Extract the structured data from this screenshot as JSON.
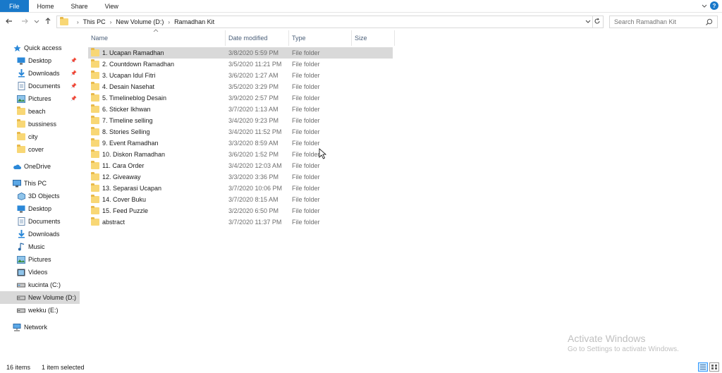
{
  "ribbon": {
    "tabs": [
      "File",
      "Home",
      "Share",
      "View"
    ]
  },
  "address": {
    "crumbs": [
      "This PC",
      "New Volume (D:)",
      "Ramadhan Kit"
    ]
  },
  "search": {
    "placeholder": "Search Ramadhan Kit"
  },
  "sidebar": {
    "items": [
      {
        "label": "Quick access",
        "icon": "star-icon"
      },
      {
        "label": "Desktop",
        "icon": "desktop-icon",
        "pinned": true
      },
      {
        "label": "Downloads",
        "icon": "download-icon",
        "pinned": true
      },
      {
        "label": "Documents",
        "icon": "documents-icon",
        "pinned": true
      },
      {
        "label": "Pictures",
        "icon": "pictures-icon",
        "pinned": true
      },
      {
        "label": "beach",
        "icon": "folder-icon"
      },
      {
        "label": "bussiness",
        "icon": "folder-icon"
      },
      {
        "label": "city",
        "icon": "folder-icon"
      },
      {
        "label": "cover",
        "icon": "folder-icon"
      },
      {
        "label": "OneDrive",
        "icon": "cloud-icon"
      },
      {
        "label": "This PC",
        "icon": "computer-icon"
      },
      {
        "label": "3D Objects",
        "icon": "cube-icon"
      },
      {
        "label": "Desktop",
        "icon": "desktop-icon"
      },
      {
        "label": "Documents",
        "icon": "documents-icon"
      },
      {
        "label": "Downloads",
        "icon": "download-icon"
      },
      {
        "label": "Music",
        "icon": "music-icon"
      },
      {
        "label": "Pictures",
        "icon": "pictures-icon"
      },
      {
        "label": "Videos",
        "icon": "video-icon"
      },
      {
        "label": "kucinta (C:)",
        "icon": "drive-icon"
      },
      {
        "label": "New Volume (D:)",
        "icon": "drive-icon"
      },
      {
        "label": "wekku (E:)",
        "icon": "drive-icon"
      },
      {
        "label": "Network",
        "icon": "network-icon"
      }
    ]
  },
  "columns": {
    "name": "Name",
    "date": "Date modified",
    "type": "Type",
    "size": "Size"
  },
  "files": [
    {
      "name": "1. Ucapan Ramadhan",
      "date": "3/8/2020 5:59 PM",
      "type": "File folder"
    },
    {
      "name": "2. Countdown Ramadhan",
      "date": "3/5/2020 11:21 PM",
      "type": "File folder"
    },
    {
      "name": "3. Ucapan Idul Fitri",
      "date": "3/6/2020 1:27 AM",
      "type": "File folder"
    },
    {
      "name": "4. Desain Nasehat",
      "date": "3/5/2020 3:29 PM",
      "type": "File folder"
    },
    {
      "name": "5. Timelineblog Desain",
      "date": "3/9/2020 2:57 PM",
      "type": "File folder"
    },
    {
      "name": "6. Sticker Ikhwan",
      "date": "3/7/2020 1:13 AM",
      "type": "File folder"
    },
    {
      "name": "7. Timeline selling",
      "date": "3/4/2020 9:23 PM",
      "type": "File folder"
    },
    {
      "name": "8. Stories Selling",
      "date": "3/4/2020 11:52 PM",
      "type": "File folder"
    },
    {
      "name": "9. Event Ramadhan",
      "date": "3/3/2020 8:59 AM",
      "type": "File folder"
    },
    {
      "name": "10. Diskon Ramadhan",
      "date": "3/6/2020 1:52 PM",
      "type": "File folder"
    },
    {
      "name": "11. Cara Order",
      "date": "3/4/2020 12:03 AM",
      "type": "File folder"
    },
    {
      "name": "12. Giveaway",
      "date": "3/3/2020 3:36 PM",
      "type": "File folder"
    },
    {
      "name": "13. Separasi Ucapan",
      "date": "3/7/2020 10:06 PM",
      "type": "File folder"
    },
    {
      "name": "14. Cover Buku",
      "date": "3/7/2020 8:15 AM",
      "type": "File folder"
    },
    {
      "name": "15. Feed Puzzle",
      "date": "3/2/2020 6:50 PM",
      "type": "File folder"
    },
    {
      "name": "abstract",
      "date": "3/7/2020 11:37 PM",
      "type": "File folder"
    }
  ],
  "status": {
    "items": "16 items",
    "selected": "1 item selected"
  },
  "watermark": {
    "title": "Activate Windows",
    "subtitle": "Go to Settings to activate Windows."
  },
  "colors": {
    "accent": "#1979ca",
    "folder": "#f8d775",
    "selection": "#d9d9d9"
  }
}
